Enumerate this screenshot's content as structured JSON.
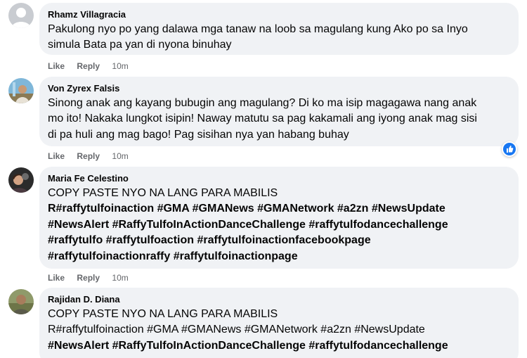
{
  "actions": {
    "like": "Like",
    "reply": "Reply"
  },
  "comments": [
    {
      "author": "Rhamz Villagracia",
      "lines": [
        "Pakulong nyo po yang dalawa mga tanaw na loob sa magulang kung Ako po sa Inyo",
        "simula Bata pa yan di nyona binuhay"
      ],
      "time": "10m"
    },
    {
      "author": "Von Zyrex Falsis",
      "lines": [
        "Sinong anak ang kayang bubugin ang magulang? Di ko ma isip magagawa nang anak",
        "mo ito! Nakaka lungkot isipin! Naway matutu sa pag kakamali ang iyong anak mag sisi",
        "di pa huli ang mag bago! Pag sisihan nya yan habang buhay"
      ],
      "time": "10m"
    },
    {
      "author": "Maria Fe Celestino",
      "lines": [
        "COPY PASTE NYO NA LANG PARA MABILIS",
        "R#raffytulfoinaction #GMA #GMANews #GMANetwork #a2zn #NewsUpdate",
        "#NewsAlert #RaffyTulfoInActionDanceChallenge #raffytulfodancechallenge",
        "#raffytulfo #raffytulfoaction #raffytulfoinactionfacebookpage",
        "#raffytulfoinactionraffy #raffytulfoinactionpage"
      ],
      "time": "10m"
    },
    {
      "author": "Rajidan D. Diana",
      "lines": [
        "COPY PASTE NYO NA LANG PARA MABILIS",
        "R#raffytulfoinaction #GMA #GMANews #GMANetwork #a2zn #NewsUpdate",
        "#NewsAlert #RaffyTulfoInActionDanceChallenge #raffytulfodancechallenge"
      ]
    }
  ],
  "reaction_icon": "like-reaction-icon",
  "colors": {
    "bubble": "#f0f2f5",
    "meta": "#65676b",
    "like_blue": "#1877f2"
  }
}
